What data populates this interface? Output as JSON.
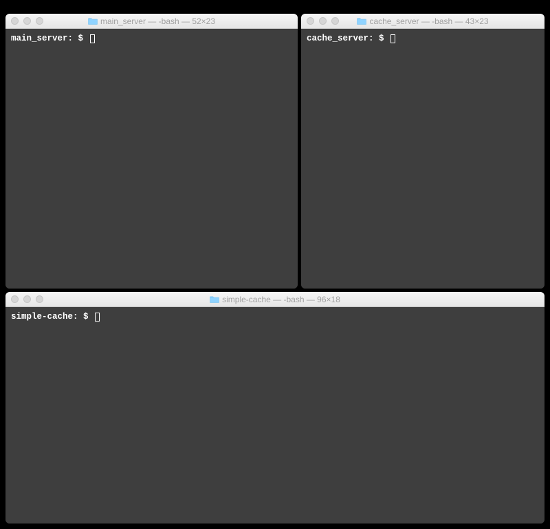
{
  "windows": {
    "main": {
      "title": "main_server — -bash — 52×23",
      "prompt": "main_server: $ "
    },
    "cache": {
      "title": "cache_server — -bash — 43×23",
      "prompt": "cache_server: $ "
    },
    "simple": {
      "title": "simple-cache — -bash — 96×18",
      "prompt": "simple-cache: $ "
    }
  }
}
